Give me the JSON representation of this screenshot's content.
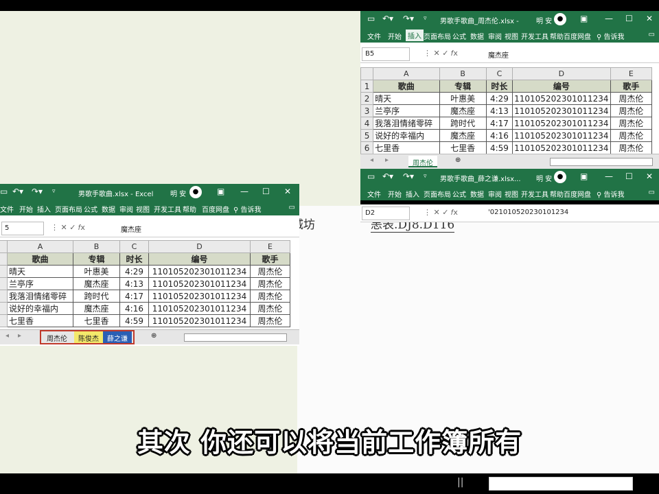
{
  "left_window": {
    "title": "男歌手歌曲.xlsx - Excel",
    "user": "明 安",
    "menu": [
      "文件",
      "开始",
      "插入",
      "页面布局",
      "公式",
      "数据",
      "审阅",
      "视图",
      "开发工具",
      "帮助",
      "百度网盘",
      "告诉我"
    ],
    "name_box": "5",
    "formula_value": "魔杰座",
    "col_headers": [
      "A",
      "B",
      "C",
      "D",
      "E"
    ],
    "rows": [
      [
        "歌曲",
        "专辑",
        "时长",
        "编号",
        "歌手"
      ],
      [
        "晴天",
        "叶惠美",
        "4:29",
        "110105202301011234",
        "周杰伦"
      ],
      [
        "兰亭序",
        "魔杰座",
        "4:13",
        "110105202301011234",
        "周杰伦"
      ],
      [
        "我落泪情绪零碎",
        "跨时代",
        "4:17",
        "110105202301011234",
        "周杰伦"
      ],
      [
        "说好的幸福内",
        "魔杰座",
        "4:16",
        "110105202301011234",
        "周杰伦"
      ],
      [
        "七里香",
        "七里香",
        "4:59",
        "110105202301011234",
        "周杰伦"
      ]
    ],
    "tabs": [
      "周杰伦",
      "陈俊杰",
      "薛之谦"
    ]
  },
  "top_right_window": {
    "title": "男歌手歌曲_周杰伦.xlsx  -",
    "user": "明 安",
    "menu": [
      "文件",
      "开始",
      "插入",
      "页面布局",
      "公式",
      "数据",
      "审阅",
      "视图",
      "开发工具",
      "帮助",
      "百度网盘",
      "告诉我"
    ],
    "name_box": "B5",
    "formula_value": "魔杰座",
    "col_headers": [
      "A",
      "B",
      "C",
      "D",
      "E"
    ],
    "row_numbers": [
      "1",
      "2",
      "3",
      "4",
      "5",
      "6"
    ],
    "rows": [
      [
        "歌曲",
        "专辑",
        "时长",
        "编号",
        "歌手"
      ],
      [
        "晴天",
        "叶惠美",
        "4:29",
        "110105202301011234",
        "周杰伦"
      ],
      [
        "兰亭序",
        "魔杰座",
        "4:13",
        "110105202301011234",
        "周杰伦"
      ],
      [
        "我落泪情绪零碎",
        "跨时代",
        "4:17",
        "110105202301011234",
        "周杰伦"
      ],
      [
        "说好的幸福内",
        "魔杰座",
        "4:16",
        "110105202301011234",
        "周杰伦"
      ],
      [
        "七里香",
        "七里香",
        "4:59",
        "110105202301011234",
        "周杰伦"
      ]
    ],
    "tabs": [
      "周杰伦"
    ]
  },
  "bottom_right_window": {
    "title": "男歌手歌曲_薛之谦.xlsx...",
    "user": "明 安",
    "menu": [
      "文件",
      "开始",
      "插入",
      "页面布局",
      "公式",
      "数据",
      "审阅",
      "视图",
      "开发工具",
      "帮助",
      "百度网盘",
      "告诉我"
    ],
    "name_box": "D2",
    "formula_value": "'021010520230101234"
  },
  "partial_text": [
    "城坊",
    "恙表.DJ8.D116"
  ],
  "caption": "其次 你还可以将当前工作簿所有",
  "colors": {
    "excel_green": "#217346",
    "tab_yellow": "#f4e96b",
    "tab_blue": "#2a5fb5",
    "tab_highlight_border": "#c0392b"
  }
}
